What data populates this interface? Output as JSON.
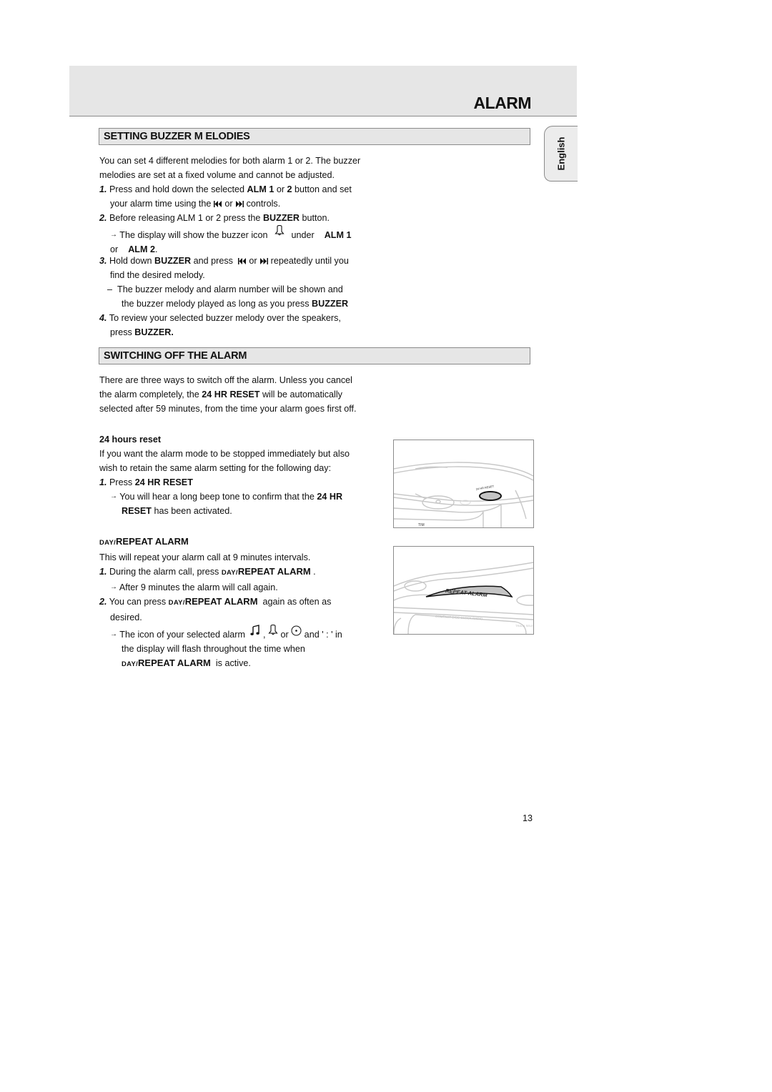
{
  "header": {
    "title": "ALARM"
  },
  "language_tab": {
    "label": "English"
  },
  "section_buzzer": {
    "heading": "SETTING BUZZER M ELODIES",
    "intro_line1": "You can set 4 different melodies for both alarm 1 or 2. The buzzer",
    "intro_line2": "melodies are set at a fixed volume and cannot be adjusted.",
    "step1": {
      "num": "1.",
      "a": "Press and hold down the selected ",
      "b": "ALM 1",
      "c": " or ",
      "d": "2",
      "e": " button and set",
      "line2a": "your alarm time using the ",
      "line2b": " or ",
      "line2c": " controls."
    },
    "step2": {
      "num": "2.",
      "a": "Before releasing ALM 1 or 2 press the ",
      "b": "BUZZER",
      "c": " button.",
      "result_a": "The display will show the buzzer icon ",
      "result_b": " under ",
      "result_c": "ALM 1",
      "result_d": "or ",
      "result_e": "ALM 2",
      "result_f": "."
    },
    "step3": {
      "num": "3.",
      "a": "Hold down ",
      "b": "BUZZER",
      "c": " and press ",
      "d": " or ",
      "e": " repeatedly until you",
      "line2": "find the desired melody.",
      "dash_line1": "The buzzer melody and alarm number will be shown and",
      "dash_line2a": "the buzzer melody played as long as you press ",
      "dash_line2b": "BUZZER"
    },
    "step4": {
      "num": "4.",
      "a": "To review your selected buzzer melody over the speakers,",
      "line2a": "press ",
      "line2b": "BUZZER."
    }
  },
  "section_off": {
    "heading": "SWITCHING OFF THE ALARM",
    "intro_line1": "There are three ways to switch off the alarm. Unless you cancel",
    "intro_line2a": "the alarm completely, the ",
    "intro_line2b": "24 HR RESET",
    "intro_line2c": " will be automatically",
    "intro_line3": "selected after 59 minutes, from the time your alarm goes first off.",
    "reset": {
      "heading": "24 hours reset",
      "line1": "If you want the alarm mode to be stopped immediately but also",
      "line2": "wish to retain the same alarm setting for the following day:",
      "step1_num": "1.",
      "step1_a": "Press ",
      "step1_b": "24 HR RESET",
      "result_a": "You will hear a long beep tone to confirm that the ",
      "result_b": "24 HR",
      "result_c": "RESET",
      "result_d": " has been activated."
    },
    "repeat": {
      "heading_sc": "DAY/",
      "heading_b": "REPEAT ALARM",
      "line1": "This will repeat your alarm call at 9 minutes intervals.",
      "step1_num": "1.",
      "step1_a": "During the alarm call, press ",
      "step1_sc": "DAY/",
      "step1_b": "REPEAT ALARM",
      "step1_c": " .",
      "step1_result": "After 9 minutes the alarm will call again.",
      "step2_num": "2.",
      "step2_a": "You can press ",
      "step2_sc": "DAY/",
      "step2_b": "REPEAT ALARM",
      "step2_c": "  again as often as",
      "step2_line2": "desired.",
      "result_a": "The icon of your selected alarm ",
      "result_b": " , ",
      "result_c": " or ",
      "result_d": " and ' : ' in",
      "result_line2": "the display will flash throughout the time when",
      "result_line3_sc": "DAY/",
      "result_line3_b": "REPEAT ALARM",
      "result_line3_c": "  is active."
    }
  },
  "figures": {
    "fig1_label": "TIM",
    "fig2_button_label": "REPEAT ALARM",
    "fig2_panel_label": "COMPACT DISC CLOCK RADIO",
    "fig2_track_label": "TRACK SELECT"
  },
  "icons": {
    "arrow": "→",
    "dash": "–",
    "prev": "prev-track-icon",
    "next": "next-track-icon",
    "bell": "bell-icon",
    "note": "music-note-icon",
    "radio": "radio-dot-icon"
  },
  "footer": {
    "page_number": "13"
  }
}
